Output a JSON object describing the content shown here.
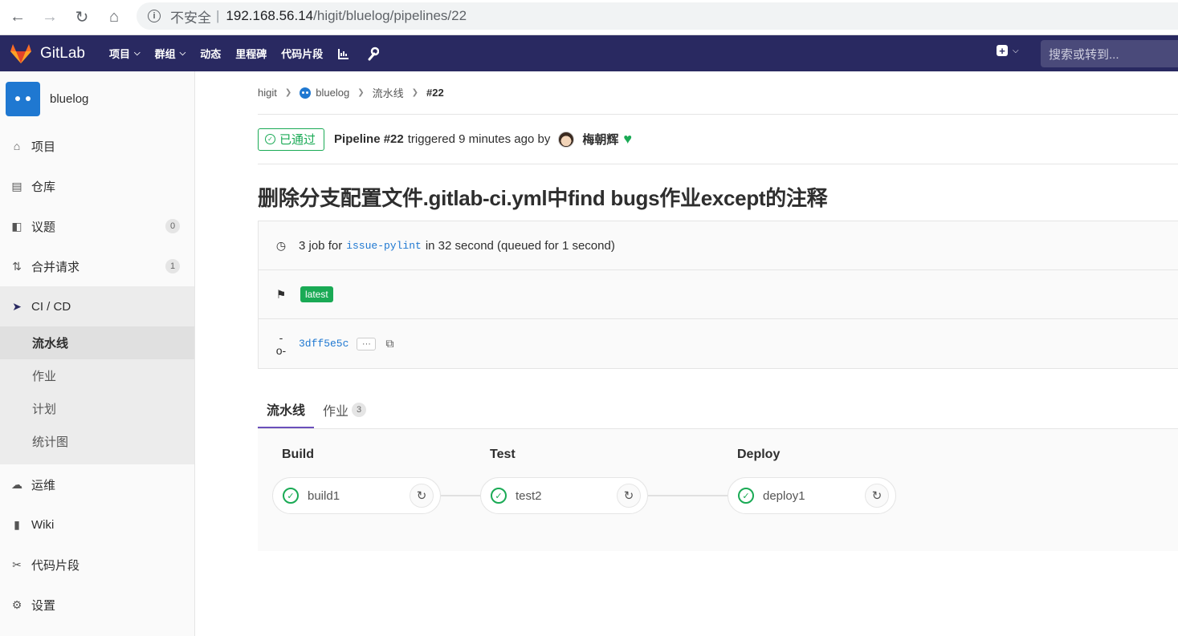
{
  "browser": {
    "security_label": "不安全",
    "separator": "|",
    "url_host": "192.168.56.14",
    "url_path": "/higit/bluelog/pipelines/22"
  },
  "header": {
    "brand": "GitLab",
    "nav": [
      {
        "label": "项目",
        "dropdown": true
      },
      {
        "label": "群组",
        "dropdown": true
      },
      {
        "label": "动态",
        "dropdown": false
      },
      {
        "label": "里程碑",
        "dropdown": false
      },
      {
        "label": "代码片段",
        "dropdown": false
      }
    ],
    "search_placeholder": "搜索或转到..."
  },
  "sidebar": {
    "project_name": "bluelog",
    "items": [
      {
        "label": "项目",
        "icon": "home-icon"
      },
      {
        "label": "仓库",
        "icon": "doc-icon"
      },
      {
        "label": "议题",
        "icon": "issues-icon",
        "count": "0"
      },
      {
        "label": "合并请求",
        "icon": "merge-request-icon",
        "count": "1"
      },
      {
        "label": "CI / CD",
        "icon": "rocket-icon"
      }
    ],
    "cicd_sub": [
      {
        "label": "流水线"
      },
      {
        "label": "作业"
      },
      {
        "label": "计划"
      },
      {
        "label": "统计图"
      }
    ],
    "items_after": [
      {
        "label": "运维",
        "icon": "cloud-gear-icon"
      },
      {
        "label": "Wiki",
        "icon": "book-icon"
      },
      {
        "label": "代码片段",
        "icon": "scissors-icon"
      },
      {
        "label": "设置",
        "icon": "gear-icon"
      }
    ]
  },
  "breadcrumb": {
    "group": "higit",
    "project": "bluelog",
    "section": "流水线",
    "current": "#22"
  },
  "pipeline": {
    "status": "已通过",
    "title_prefix": "Pipeline #22",
    "triggered_text": "triggered 9 minutes ago by",
    "user": "梅朝辉",
    "commit_title": "删除分支配置文件.gitlab-ci.yml中find bugs作业except的注释",
    "jobs_prefix": "3 job for",
    "branch": "issue-pylint",
    "duration_text": "in 32 second (queued for 1 second)",
    "tag": "latest",
    "sha": "3dff5e5c",
    "ellipsis": "···"
  },
  "tabs": {
    "pipeline": "流水线",
    "jobs": "作业",
    "jobs_count": "3"
  },
  "stages": [
    {
      "name": "Build",
      "job": "build1"
    },
    {
      "name": "Test",
      "job": "test2"
    },
    {
      "name": "Deploy",
      "job": "deploy1"
    }
  ],
  "colors": {
    "header_bg": "#292961",
    "success": "#1aaa55",
    "link": "#1f78d1",
    "tab_active": "#6b4fbb"
  }
}
